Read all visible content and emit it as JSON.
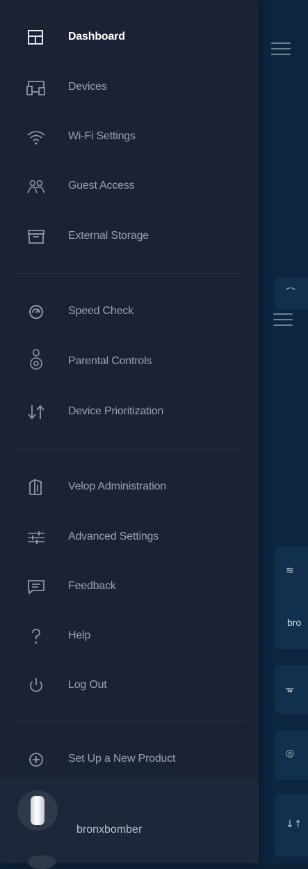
{
  "navigation": {
    "items": [
      {
        "label": "Dashboard",
        "icon": "dashboard-icon",
        "active": true
      },
      {
        "label": "Devices",
        "icon": "devices-icon"
      },
      {
        "label": "Wi-Fi Settings",
        "icon": "wifi-icon"
      },
      {
        "label": "Guest Access",
        "icon": "guest-access-icon"
      },
      {
        "label": "External Storage",
        "icon": "external-storage-icon"
      },
      {
        "label": "Speed Check",
        "icon": "speedometer-icon"
      },
      {
        "label": "Parental Controls",
        "icon": "parental-controls-icon"
      },
      {
        "label": "Device Prioritization",
        "icon": "prioritization-arrows-icon"
      },
      {
        "label": "Velop Administration",
        "icon": "velop-node-icon"
      },
      {
        "label": "Advanced Settings",
        "icon": "sliders-icon"
      },
      {
        "label": "Feedback",
        "icon": "feedback-icon"
      },
      {
        "label": "Help",
        "icon": "help-icon"
      },
      {
        "label": "Log Out",
        "icon": "power-icon"
      },
      {
        "label": "Set Up a New Product",
        "icon": "add-circle-icon"
      }
    ]
  },
  "account": {
    "name": "bronxbomber"
  },
  "background": {
    "partial_label": "bro"
  },
  "colors": {
    "drawer": "#1a2233",
    "background_app": "#0c2640",
    "active_text": "#ffffff",
    "inactive_text": "#9aa3b0"
  }
}
